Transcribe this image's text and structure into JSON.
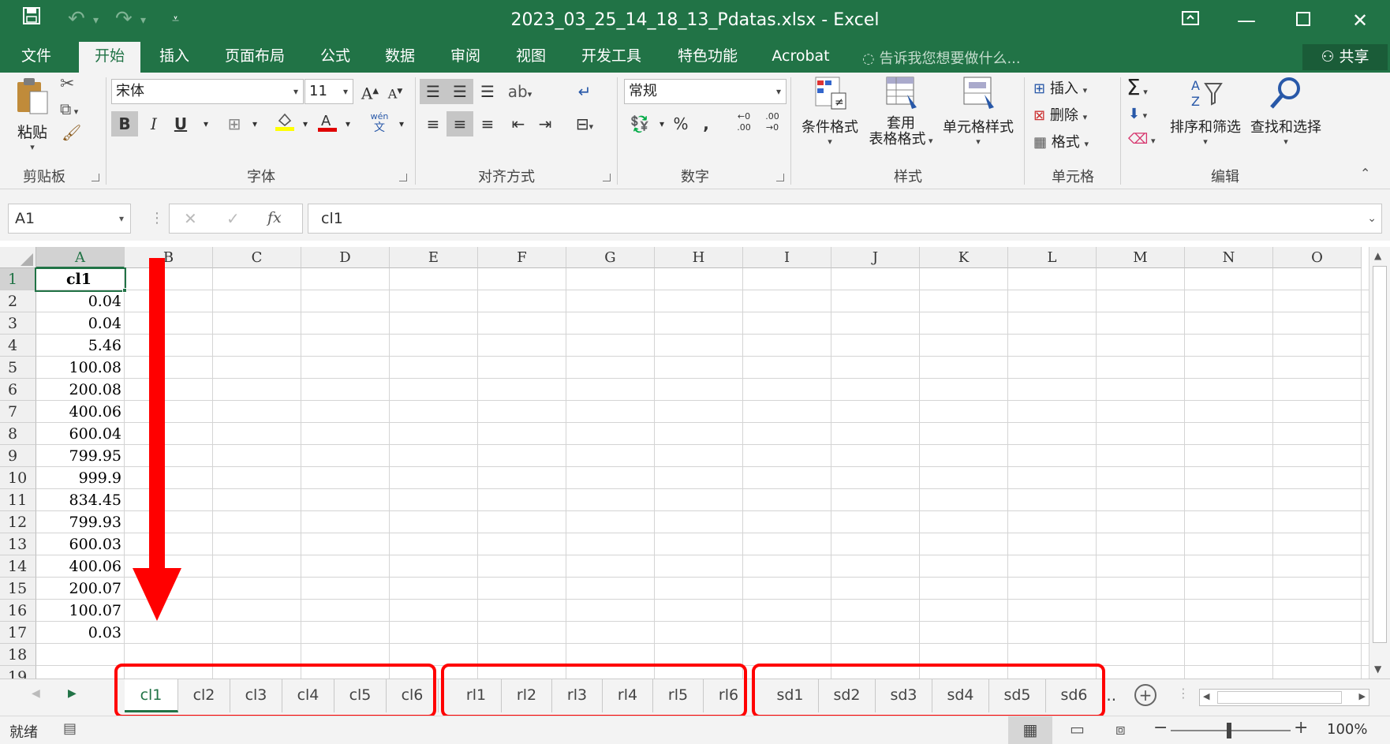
{
  "window": {
    "title": "2023_03_25_14_18_13_Pdatas.xlsx - Excel"
  },
  "quick_access": {
    "save_icon": "save-icon",
    "undo_icon": "undo-icon",
    "redo_icon": "redo-icon"
  },
  "menu_tabs": [
    "文件",
    "开始",
    "插入",
    "页面布局",
    "公式",
    "数据",
    "审阅",
    "视图",
    "开发工具",
    "特色功能",
    "Acrobat"
  ],
  "tell_me": "告诉我您想要做什么...",
  "share": "共享",
  "ribbon": {
    "clipboard": {
      "paste": "粘贴",
      "label": "剪贴板"
    },
    "font": {
      "name": "宋体",
      "size": "11",
      "bold": "B",
      "italic": "I",
      "underline": "U",
      "label": "字体",
      "grow": "A",
      "shrink": "A",
      "wen": "wén",
      "wen_char": "文"
    },
    "alignment": {
      "label": "对齐方式"
    },
    "number": {
      "format": "常规",
      "percent": "%",
      "comma": ",",
      "label": "数字",
      "inc_decimal": ".00",
      "dec_decimal": ".00"
    },
    "styles": {
      "conditional": "条件格式",
      "table_top": "套用",
      "table_bottom": "表格格式",
      "cell_styles": "单元格样式",
      "label": "样式"
    },
    "cells": {
      "insert": "插入",
      "delete": "删除",
      "format": "格式",
      "label": "单元格"
    },
    "editing": {
      "sum": "Σ",
      "sort_filter": "排序和筛选",
      "find_select": "查找和选择",
      "label": "编辑"
    }
  },
  "formula_bar": {
    "name_box": "A1",
    "fx": "fx",
    "content": "cl1"
  },
  "columns": [
    "A",
    "B",
    "C",
    "D",
    "E",
    "F",
    "G",
    "H",
    "I",
    "J",
    "K",
    "L",
    "M",
    "N",
    "O"
  ],
  "rows": [
    "1",
    "2",
    "3",
    "4",
    "5",
    "6",
    "7",
    "8",
    "9",
    "10",
    "11",
    "12",
    "13",
    "14",
    "15",
    "16",
    "17",
    "18",
    "19"
  ],
  "column_a_values": [
    "cl1",
    "0.04",
    "0.04",
    "5.46",
    "100.08",
    "200.08",
    "400.06",
    "600.04",
    "799.95",
    "999.9",
    "834.45",
    "799.93",
    "600.03",
    "400.06",
    "200.07",
    "100.07",
    "0.03",
    "",
    ""
  ],
  "sheet_tabs": [
    "cl1",
    "cl2",
    "cl3",
    "cl4",
    "cl5",
    "cl6",
    "rl1",
    "rl2",
    "rl3",
    "rl4",
    "rl5",
    "rl6",
    "sd1",
    "sd2",
    "sd3",
    "sd4",
    "sd5",
    "sd6"
  ],
  "tabs_more": "...",
  "status": {
    "ready": "就绪",
    "zoom": "100%",
    "zoom_minus": "−",
    "zoom_plus": "+"
  },
  "colors": {
    "excel_green": "#217346",
    "highlight_red": "#ff0000"
  }
}
